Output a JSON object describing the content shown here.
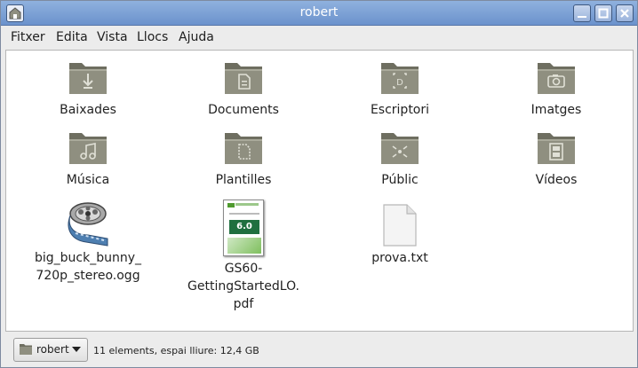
{
  "window": {
    "title": "robert"
  },
  "menubar": {
    "items": [
      "Fitxer",
      "Edita",
      "Vista",
      "Llocs",
      "Ajuda"
    ]
  },
  "files": [
    {
      "label": "Baixades",
      "icon": "downloads-folder-icon"
    },
    {
      "label": "Documents",
      "icon": "documents-folder-icon"
    },
    {
      "label": "Escriptori",
      "icon": "desktop-folder-icon"
    },
    {
      "label": "Imatges",
      "icon": "pictures-folder-icon"
    },
    {
      "label": "Música",
      "icon": "music-folder-icon"
    },
    {
      "label": "Plantilles",
      "icon": "templates-folder-icon"
    },
    {
      "label": "Públic",
      "icon": "public-folder-icon"
    },
    {
      "label": "Vídeos",
      "icon": "videos-folder-icon"
    },
    {
      "label_lines": [
        "big_buck_bunny_",
        "720p_stereo.ogg"
      ],
      "icon": "film-reel-icon"
    },
    {
      "label_lines": [
        "GS60-",
        "GettingStartedLO.",
        "pdf"
      ],
      "icon": "pdf-thumbnail-icon",
      "thumb_text": "6.0"
    },
    {
      "label": "prova.txt",
      "icon": "text-file-icon"
    }
  ],
  "statusbar": {
    "location": "robert",
    "info": "11 elements, espai lliure: 12,4 GB"
  },
  "colors": {
    "titlebar": "#7aa0d6",
    "folder": "#8f8f80",
    "folder_dark": "#6e6e60"
  }
}
